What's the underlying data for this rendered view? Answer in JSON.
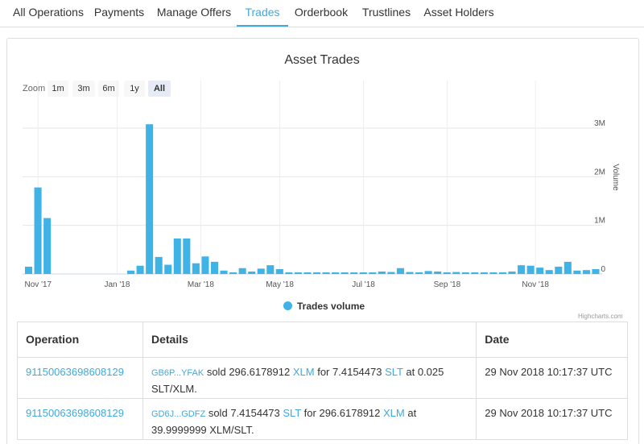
{
  "tabs": [
    {
      "label": "All Operations",
      "active": false
    },
    {
      "label": "Payments",
      "active": false
    },
    {
      "label": "Manage Offers",
      "active": false
    },
    {
      "label": "Trades",
      "active": true
    },
    {
      "label": "Orderbook",
      "active": false
    },
    {
      "label": "Trustlines",
      "active": false
    },
    {
      "label": "Asset Holders",
      "active": false
    }
  ],
  "chart": {
    "zoom_label": "Zoom",
    "zoom_buttons": [
      "1m",
      "3m",
      "6m",
      "1y",
      "All"
    ],
    "zoom_active": "All",
    "legend_label": "Trades volume",
    "credits": "Highcharts.com",
    "accent_color": "#3fb3e6"
  },
  "chart_data": {
    "type": "bar",
    "title": "Asset Trades",
    "ylabel": "Volume",
    "xlabel": "",
    "ylim": [
      0,
      3500000
    ],
    "y_ticks": [
      "0",
      "1M",
      "2M",
      "3M"
    ],
    "x_ticks": [
      "Nov '17",
      "Jan '18",
      "Mar '18",
      "May '18",
      "Jul '18",
      "Sep '18",
      "Nov '18"
    ],
    "values": [
      150000,
      1780000,
      1150000,
      0,
      0,
      0,
      0,
      0,
      0,
      0,
      0,
      70000,
      170000,
      3080000,
      350000,
      190000,
      730000,
      730000,
      220000,
      360000,
      250000,
      70000,
      30000,
      120000,
      50000,
      110000,
      180000,
      100000,
      30000,
      30000,
      30000,
      30000,
      20000,
      30000,
      20000,
      30000,
      20000,
      30000,
      50000,
      40000,
      120000,
      40000,
      30000,
      60000,
      50000,
      30000,
      40000,
      30000,
      20000,
      20000,
      30000,
      20000,
      50000,
      180000,
      170000,
      130000,
      80000,
      150000,
      250000,
      70000,
      80000,
      100000
    ]
  },
  "table": {
    "headers": {
      "operation": "Operation",
      "details": "Details",
      "date": "Date"
    },
    "rows": [
      {
        "operation": "91150063698608129",
        "account": "GB6P...YFAK",
        "verb": "sold",
        "amount1": "296.6178912",
        "asset1": "XLM",
        "for": "for",
        "amount2": "7.4154473",
        "asset2": "SLT",
        "at": "at 0.025",
        "pair": "SLT/XLM.",
        "date": "29 Nov 2018 10:17:37 UTC"
      },
      {
        "operation": "91150063698608129",
        "account": "GD6J...GDFZ",
        "verb": "sold",
        "amount1": "7.4154473",
        "asset1": "SLT",
        "for": "for",
        "amount2": "296.6178912",
        "asset2": "XLM",
        "at": "at",
        "pair": "39.9999999 XLM/SLT.",
        "date": "29 Nov 2018 10:17:37 UTC"
      }
    ]
  }
}
